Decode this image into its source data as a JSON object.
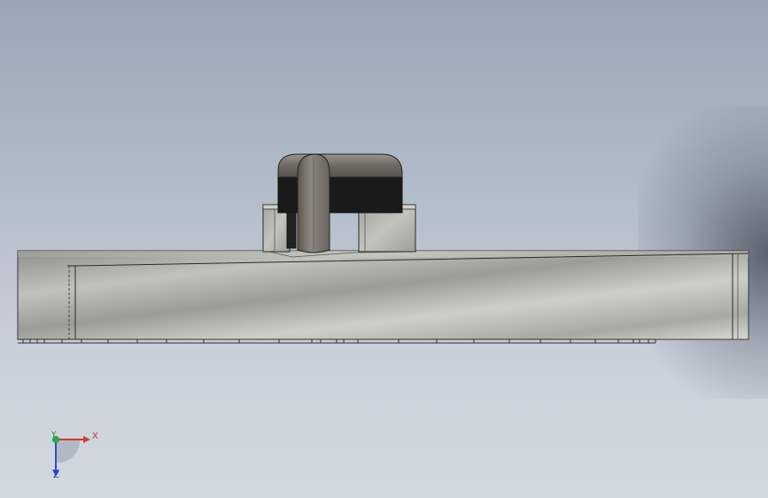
{
  "viewport": {
    "background_top": "#9aa6b6",
    "background_bottom": "#d2d8df"
  },
  "model": {
    "plate_color": "#b4b4ae",
    "component_body_color": "#1a1a1a",
    "component_cap_color": "#7a746e",
    "pad_color": "#b9b9b3"
  },
  "triad": {
    "x_label": "X",
    "y_label": "Y",
    "z_label": "Z",
    "x_color": "#d63a2a",
    "y_color": "#27a844",
    "z_color": "#2a4fd0"
  }
}
